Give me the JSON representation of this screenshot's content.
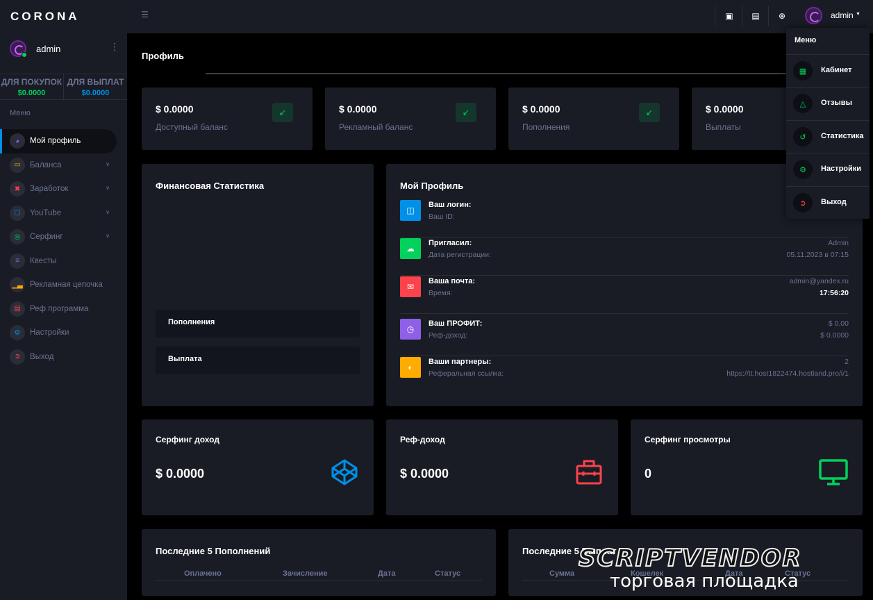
{
  "brand": "CORONA",
  "sidebar": {
    "user": "admin",
    "balances": [
      {
        "label": "ДЛЯ ПОКУПОК",
        "value": "$0.0000",
        "color": "#00d25b"
      },
      {
        "label": "ДЛЯ ВЫПЛАТ",
        "value": "$0.0000",
        "color": "#0090e7"
      }
    ],
    "menu_label": "Меню",
    "items": [
      {
        "label": "Мой профиль",
        "icon": "speedometer-icon",
        "color": "#8f5fe8"
      },
      {
        "label": "Баланса",
        "icon": "laptop-icon",
        "color": "#ffab00"
      },
      {
        "label": "Заработок",
        "icon": "close-circle-icon",
        "color": "#fc424a"
      },
      {
        "label": "YouTube",
        "icon": "monitor-icon",
        "color": "#0090e7"
      },
      {
        "label": "Серфинг",
        "icon": "fingerprint-icon",
        "color": "#00d25b"
      },
      {
        "label": "Квесты",
        "icon": "list-icon",
        "color": "#8f5fe8"
      },
      {
        "label": "Рекламная цепочка",
        "icon": "chart-bar-icon",
        "color": "#ffab00"
      },
      {
        "label": "Реф программа",
        "icon": "contacts-icon",
        "color": "#fc424a"
      },
      {
        "label": "Настройки",
        "icon": "settings-icon",
        "color": "#0090e7"
      },
      {
        "label": "Выход",
        "icon": "logout-icon",
        "color": "#fc424a"
      }
    ]
  },
  "topbar": {
    "user": "admin"
  },
  "page_title": "Профиль",
  "stats": [
    {
      "value": "$ 0.0000",
      "label": "Доступный баланс"
    },
    {
      "value": "$ 0.0000",
      "label": "Рекламный баланс"
    },
    {
      "value": "$ 0.0000",
      "label": "Пополнения"
    },
    {
      "value": "$ 0.0000",
      "label": "Выплаты"
    }
  ],
  "finance": {
    "title": "Финансовая Статистика",
    "items": [
      "Пополнения",
      "Выплата"
    ]
  },
  "profile": {
    "title": "Мой Профиль",
    "rows": [
      {
        "label": "Ваш логин:",
        "sub": "Ваш ID:",
        "v1": "",
        "v2": "",
        "color": "#0090e7",
        "icon": "file-icon"
      },
      {
        "label": "Пригласил:",
        "sub": "Дата регистрации:",
        "v1": "Admin",
        "v2": "05.11.2023 в 07:15",
        "color": "#00d25b",
        "icon": "cloud-download-icon"
      },
      {
        "label": "Ваша почта:",
        "sub": "Время:",
        "v1": "admin@yandex.ru",
        "v2": "17:56:20",
        "color": "#fc424a",
        "icon": "email-open-icon"
      },
      {
        "label": "Ваш ПРОФИТ:",
        "sub": "Реф-доход:",
        "v1": "$ 0.00",
        "v2": "$ 0.0000",
        "color": "#8f5fe8",
        "icon": "clock-icon"
      },
      {
        "label": "Ваши партнеры:",
        "sub": "Реферальная ссылка:",
        "v1": "2",
        "v2": "https://tt.host1822474.hostland.pro/i/1",
        "color": "#ffab00",
        "icon": "pie-chart-icon"
      }
    ]
  },
  "big_cards": [
    {
      "title": "Серфинг доход",
      "value": "$ 0.0000",
      "icon": "codepen-icon",
      "color": "#0090e7"
    },
    {
      "title": "Реф-доход",
      "value": "$ 0.0000",
      "icon": "briefcase-icon",
      "color": "#fc424a"
    },
    {
      "title": "Серфинг просмотры",
      "value": "0",
      "icon": "monitor-icon",
      "color": "#00d25b"
    }
  ],
  "recent_deposits": {
    "title": "Последние 5 Пополнений",
    "columns": [
      "Оплачено",
      "Зачисление",
      "Дата",
      "Статус"
    ]
  },
  "recent_payouts": {
    "title": "Последние 5 Выплат",
    "columns": [
      "Сумма",
      "Кошелек",
      "Дата",
      "Статус"
    ]
  },
  "dropdown": {
    "header": "Меню",
    "items": [
      {
        "label": "Кабинет",
        "icon": "card-account-icon"
      },
      {
        "label": "Отзывы",
        "icon": "share-icon"
      },
      {
        "label": "Статистика",
        "icon": "history-icon"
      },
      {
        "label": "Настройки",
        "icon": "settings-icon"
      },
      {
        "label": "Выход",
        "icon": "logout-icon"
      }
    ],
    "icon_colors": [
      "#00d25b",
      "#00d25b",
      "#00d25b",
      "#00d25b",
      "#fc424a"
    ]
  },
  "watermark": {
    "line1": "SCRIPTVENDOR",
    "line2": "торговая площадка"
  }
}
